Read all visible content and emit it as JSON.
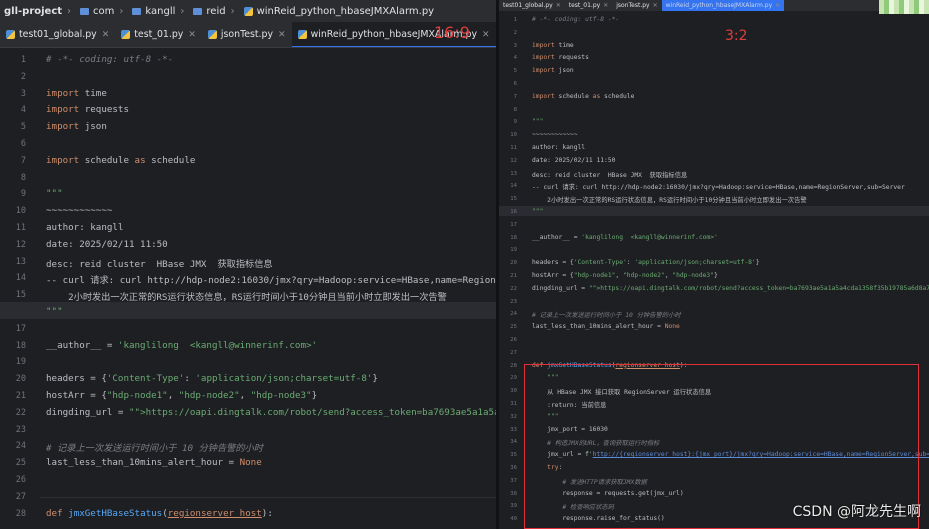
{
  "breadcrumb": {
    "project": "gll-project",
    "parts": [
      "com",
      "kangll",
      "reid"
    ],
    "file": "winReid_python_hbaseJMXAlarm.py"
  },
  "left_tabs": [
    {
      "label": "test01_global.py",
      "active": false
    },
    {
      "label": "test_01.py",
      "active": false
    },
    {
      "label": "jsonTest.py",
      "active": false
    },
    {
      "label": "winReid_python_hbaseJMXAlarm.py",
      "active": true
    }
  ],
  "left_ratio_label": "16:9",
  "right_ratio_label": "3:2",
  "right_tabs": [
    {
      "label": "test01_global.py",
      "active": false
    },
    {
      "label": "test_01.py",
      "active": false
    },
    {
      "label": "jsonTest.py",
      "active": false
    },
    {
      "label": "winReid_python_hbaseJMXAlarm.py",
      "active": true
    }
  ],
  "code_lines": [
    {
      "n": "1",
      "t": "# -*- coding: utf-8 -*-"
    },
    {
      "n": "2",
      "t": ""
    },
    {
      "n": "3",
      "t": "import time"
    },
    {
      "n": "4",
      "t": "import requests"
    },
    {
      "n": "5",
      "t": "import json"
    },
    {
      "n": "6",
      "t": ""
    },
    {
      "n": "7",
      "t": "import schedule as schedule"
    },
    {
      "n": "8",
      "t": ""
    },
    {
      "n": "9",
      "t": "\"\"\""
    },
    {
      "n": "10",
      "t": "~~~~~~~~~~~~"
    },
    {
      "n": "11",
      "t": "author: kangll"
    },
    {
      "n": "12",
      "t": "date: 2025/02/11 11:50"
    },
    {
      "n": "13",
      "t": "desc: reid cluster  HBase JMX  获取指标信息"
    },
    {
      "n": "14",
      "t": "-- curl 请求: curl http://hdp-node2:16030/jmx?qry=Hadoop:service=HBase,name=RegionServer,sub=Server"
    },
    {
      "n": "15",
      "t": "    2小时发出一次正常的RS运行状态信息，RS运行时间小于10分钟且当前小时立即发出一次告警"
    },
    {
      "n": "16",
      "t": "\"\"\""
    },
    {
      "n": "17",
      "t": ""
    },
    {
      "n": "18",
      "t": "__author__ = 'kanglilong  <kangll@winnerinf.com>'"
    },
    {
      "n": "19",
      "t": ""
    },
    {
      "n": "20",
      "t": "headers = {'Content-Type': 'application/json;charset=utf-8'}"
    },
    {
      "n": "21",
      "t": "hostArr = {\"hdp-node1\", \"hdp-node2\", \"hdp-node3\"}"
    },
    {
      "n": "22",
      "t": "dingding_url = \"https://oapi.dingtalk.com/robot/send?access_token=ba7693ae5a1a5a4cda1358f35b19785a6d8a7\""
    },
    {
      "n": "23",
      "t": ""
    },
    {
      "n": "24",
      "t": "# 记录上一次发送运行时间小于 10 分钟告警的小时"
    },
    {
      "n": "25",
      "t": "last_less_than_10mins_alert_hour = None"
    },
    {
      "n": "26",
      "t": ""
    },
    {
      "n": "27",
      "t": ""
    },
    {
      "n": "28",
      "t": "def jmxGetHBaseStatus(regionserver_host):"
    },
    {
      "n": "29",
      "t": "    \"\"\""
    },
    {
      "n": "30",
      "t": "    从 HBase JMX 接口获取 RegionServer 运行状态信息"
    },
    {
      "n": "31",
      "t": "    :return: 当前信息"
    },
    {
      "n": "32",
      "t": "    \"\"\""
    },
    {
      "n": "33",
      "t": "    jmx_port = 16030"
    },
    {
      "n": "34",
      "t": "    # 构造JMX的URL，查询获取运行时指标"
    },
    {
      "n": "35",
      "t": "    jmx_url = f'http://{regionserver_host}:{jmx_port}/jmx?qry=Hadoop:service=HBase,name=RegionServer,sub=Server'"
    },
    {
      "n": "36",
      "t": "    try:"
    },
    {
      "n": "37",
      "t": "        # 发送HTTP请求获取JMX数据"
    },
    {
      "n": "38",
      "t": "        response = requests.get(jmx_url)"
    },
    {
      "n": "39",
      "t": "        # 检查响应状态码"
    },
    {
      "n": "40",
      "t": "        response.raise_for_status()"
    }
  ],
  "watermark": "CSDN @阿龙先生啊",
  "colors": {
    "accent": "#3574f0",
    "annotation_red": "#e0313a",
    "keyword": "#cf8e6d",
    "string": "#6aab73",
    "comment": "#7a7e85"
  }
}
